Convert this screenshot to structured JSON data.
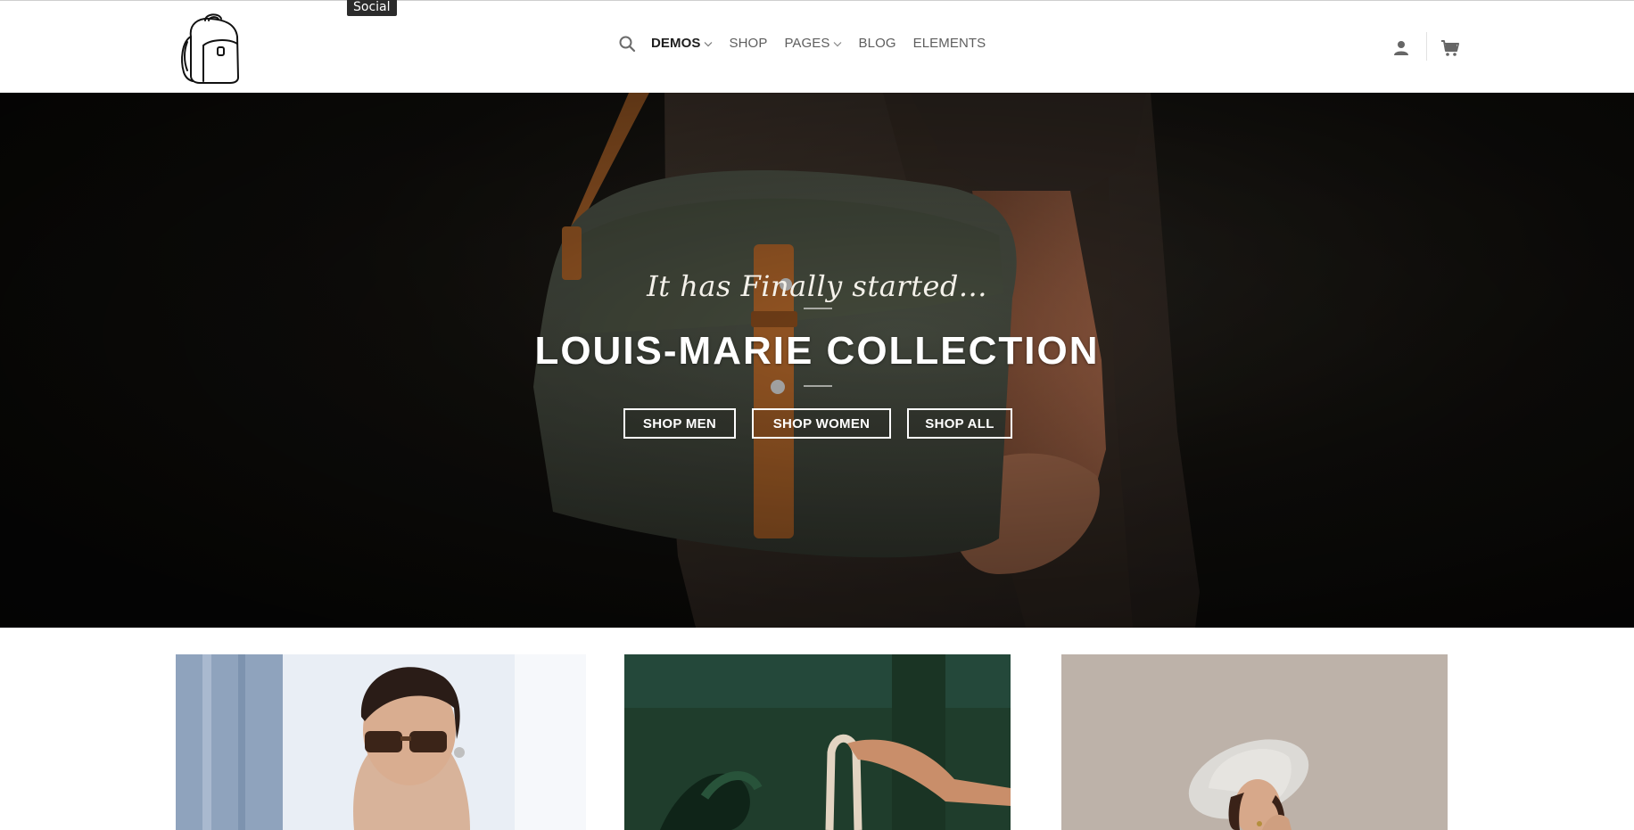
{
  "tooltip": {
    "text": "Social"
  },
  "header": {
    "logo_icon": "backpack-logo-icon",
    "nav": {
      "search_icon": "search-icon",
      "items": [
        {
          "label": "DEMOS",
          "dropdown": true,
          "active": true
        },
        {
          "label": "SHOP",
          "dropdown": false,
          "active": false
        },
        {
          "label": "PAGES",
          "dropdown": true,
          "active": false
        },
        {
          "label": "BLOG",
          "dropdown": false,
          "active": false
        },
        {
          "label": "ELEMENTS",
          "dropdown": false,
          "active": false
        }
      ]
    },
    "account_icon": "user-icon",
    "cart_icon": "cart-icon"
  },
  "hero": {
    "kicker": "It has Finally started...",
    "title": "LOUIS-MARIE COLLECTION",
    "buttons": [
      {
        "label": "SHOP MEN"
      },
      {
        "label": "SHOP WOMEN"
      },
      {
        "label": "SHOP ALL"
      }
    ]
  },
  "tiles": [
    {
      "name": "woman-sunglasses-photo"
    },
    {
      "name": "tote-bag-photo"
    },
    {
      "name": "woman-hat-photo"
    }
  ],
  "colors": {
    "nav_text": "#5e5e5e",
    "nav_active": "#1f1f1f",
    "hero_bg": "#15130f",
    "bag_green": "#4b5043",
    "strap_leather": "#b86a2c"
  }
}
